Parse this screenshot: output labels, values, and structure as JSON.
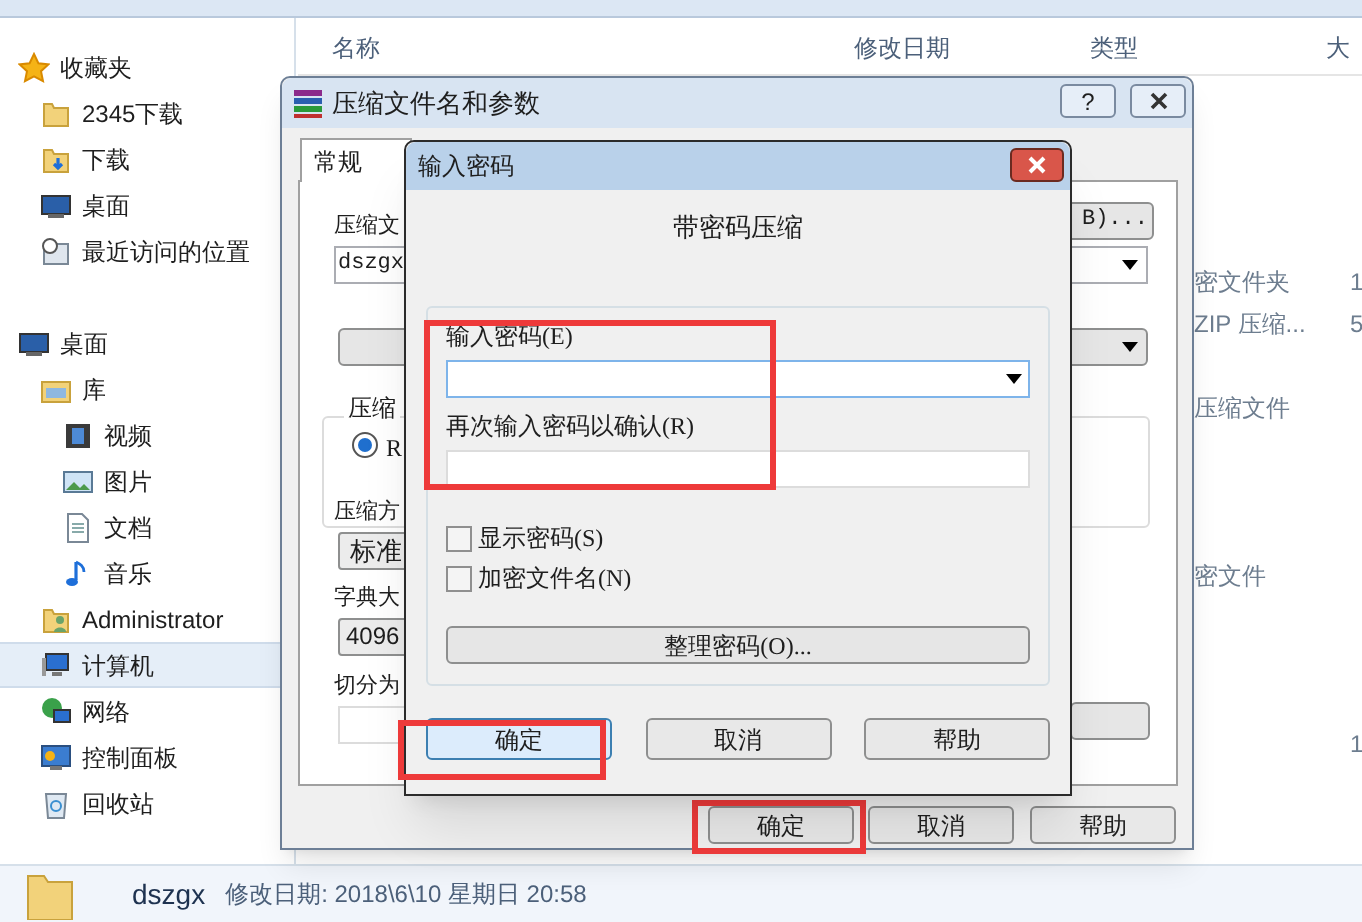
{
  "explorer": {
    "nav": [
      {
        "label": "收藏夹",
        "kind": "favorites",
        "selected": false,
        "children": [
          {
            "label": "2345下载",
            "kind": "folder",
            "selected": false
          },
          {
            "label": "下载",
            "kind": "download",
            "selected": false
          },
          {
            "label": "桌面",
            "kind": "desktop",
            "selected": false
          },
          {
            "label": "最近访问的位置",
            "kind": "recent",
            "selected": false
          }
        ]
      },
      {
        "label": "桌面",
        "kind": "desktop",
        "selected": false,
        "children": [
          {
            "label": "库",
            "kind": "library",
            "selected": false,
            "children": [
              {
                "label": "视频",
                "kind": "video",
                "selected": false
              },
              {
                "label": "图片",
                "kind": "picture",
                "selected": false
              },
              {
                "label": "文档",
                "kind": "document",
                "selected": false
              },
              {
                "label": "音乐",
                "kind": "music",
                "selected": false
              }
            ]
          },
          {
            "label": "Administrator",
            "kind": "user",
            "selected": false
          },
          {
            "label": "计算机",
            "kind": "computer",
            "selected": true
          },
          {
            "label": "网络",
            "kind": "network",
            "selected": false
          },
          {
            "label": "控制面板",
            "kind": "control",
            "selected": false
          },
          {
            "label": "回收站",
            "kind": "recycle",
            "selected": false
          }
        ]
      }
    ],
    "columns": [
      "名称",
      "修改日期",
      "类型",
      "大"
    ],
    "rows": [
      {
        "type": "密文件夹",
        "size": "1"
      },
      {
        "type": "ZIP 压缩...",
        "size": "5"
      },
      {},
      {
        "type": "压缩文件"
      },
      {},
      {},
      {},
      {
        "type": "密文件"
      },
      {},
      {},
      {},
      {
        "size": "1"
      }
    ],
    "details": {
      "name": "dszgx",
      "modified": "修改日期: 2018\\6\\10 星期日 20:58"
    }
  },
  "archive_dialog": {
    "title": "压缩文件名和参数",
    "help": "?",
    "tabs": [
      {
        "label": "常规",
        "selected": true
      }
    ],
    "archive_label": "压缩文",
    "archive_name": "dszgx",
    "browse_button": "B)...",
    "format_label": "压缩",
    "format_option": "R",
    "format_selected": true,
    "method_label": "压缩方",
    "method": "标准",
    "dict_label": "字典大",
    "dict": "4096",
    "split_label": "切分为",
    "buttons": [
      {
        "label": "确定",
        "highlighted": true
      },
      {
        "label": "取消",
        "highlighted": false
      },
      {
        "label": "帮助",
        "highlighted": false
      }
    ]
  },
  "password_dialog": {
    "title": "输入密码",
    "heading": "带密码压缩",
    "fields_highlighted": true,
    "fields": [
      {
        "label": "输入密码(E)",
        "kind": "combo"
      },
      {
        "label": "再次输入密码以确认(R)",
        "kind": "text"
      }
    ],
    "checkboxes": [
      {
        "label": "显示密码(S)",
        "checked": false
      },
      {
        "label": "加密文件名(N)",
        "checked": false
      }
    ],
    "organize_button": "整理密码(O)...",
    "buttons": [
      {
        "label": "确定",
        "default": true,
        "highlighted": true
      },
      {
        "label": "取消",
        "default": false,
        "highlighted": false
      },
      {
        "label": "帮助",
        "default": false,
        "highlighted": false
      }
    ]
  }
}
